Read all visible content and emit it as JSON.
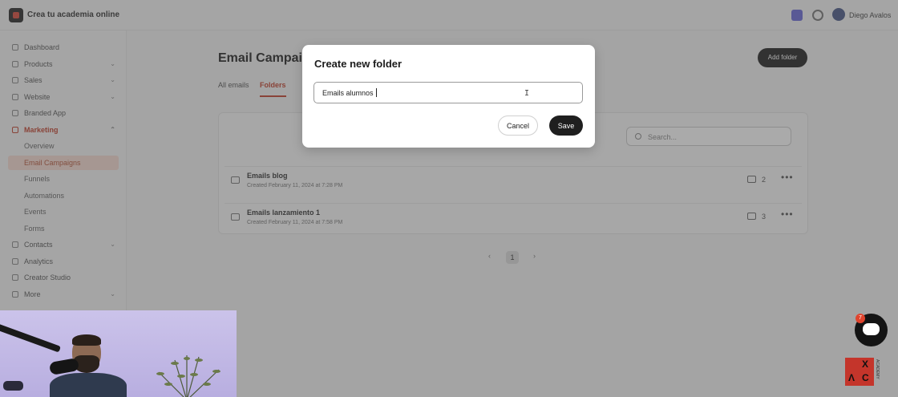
{
  "app": {
    "brand_name": "Crea tu academia online",
    "user_name": "Diego Avalos"
  },
  "sidebar": {
    "items": [
      {
        "label": "Dashboard",
        "icon": "home-icon"
      },
      {
        "label": "Products",
        "icon": "box-icon",
        "expandable": true
      },
      {
        "label": "Sales",
        "icon": "chart-icon",
        "expandable": true
      },
      {
        "label": "Website",
        "icon": "globe-icon",
        "expandable": true
      },
      {
        "label": "Branded App",
        "icon": "phone-icon"
      },
      {
        "label": "Marketing",
        "icon": "megaphone-icon",
        "expandable": true,
        "expanded": true
      },
      {
        "label": "Overview",
        "sub": true
      },
      {
        "label": "Email Campaigns",
        "sub": true,
        "active": true
      },
      {
        "label": "Funnels",
        "sub": true
      },
      {
        "label": "Automations",
        "sub": true
      },
      {
        "label": "Events",
        "sub": true
      },
      {
        "label": "Forms",
        "sub": true
      },
      {
        "label": "Contacts",
        "icon": "people-icon",
        "expandable": true
      },
      {
        "label": "Analytics",
        "icon": "analytics-icon"
      },
      {
        "label": "Creator Studio",
        "icon": "studio-icon"
      },
      {
        "label": "More",
        "icon": "more-icon",
        "expandable": true
      }
    ]
  },
  "main": {
    "title": "Email Campaigns",
    "add_folder_label": "Add folder",
    "tabs": [
      {
        "label": "All emails"
      },
      {
        "label": "Folders",
        "active": true
      }
    ],
    "search_placeholder": "Search...",
    "folders": [
      {
        "name": "Emails blog",
        "created": "Created February 11, 2024 at 7:28 PM",
        "count": "2"
      },
      {
        "name": "Emails lanzamiento 1",
        "created": "Created February 11, 2024 at 7:58 PM",
        "count": "3"
      }
    ],
    "pagination": {
      "prev": "‹",
      "current": "1",
      "next": "›"
    }
  },
  "modal": {
    "title": "Create new folder",
    "input_value": "Emails alumnos",
    "cancel_label": "Cancel",
    "save_label": "Save"
  },
  "chat_widget": {
    "badge_count": "7"
  },
  "watermark": {
    "letters": [
      "X",
      "C"
    ],
    "side_text": "ACADEMY"
  },
  "colors": {
    "accent": "#c2412d",
    "primary_button": "#1f1f1f",
    "overlay": "rgba(70,70,70,0.46)"
  }
}
